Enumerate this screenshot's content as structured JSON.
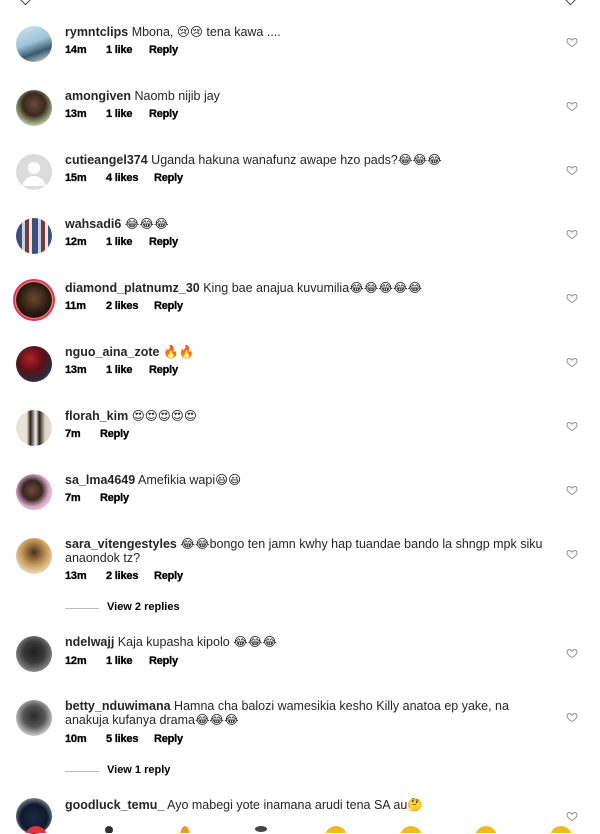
{
  "comments": [
    {
      "username": "rymntclips",
      "text": " Mbona, 😢😢 tena kawa ....",
      "time": "14m",
      "likes": "1 like",
      "reply": "Reply"
    },
    {
      "username": "amongiven",
      "text": " Naomb nijib jay",
      "time": "13m",
      "likes": "1 like",
      "reply": "Reply"
    },
    {
      "username": "cutieangel374",
      "text": " Uganda hakuna wanafunz awape hzo pads?😂😂😂",
      "time": "15m",
      "likes": "4 likes",
      "reply": "Reply"
    },
    {
      "username": "wahsadi6",
      "text": " 😂😂😂",
      "time": "12m",
      "likes": "1 like",
      "reply": "Reply"
    },
    {
      "username": "diamond_platnumz_30",
      "text": " King bae anajua kuvumilia😂😂😂😂😂",
      "time": "11m",
      "likes": "2 likes",
      "reply": "Reply"
    },
    {
      "username": "nguo_aina_zote",
      "text": " 🔥🔥",
      "time": "13m",
      "likes": "1 like",
      "reply": "Reply"
    },
    {
      "username": "florah_kim",
      "text": " 😍😍😍😍😍",
      "time": "7m",
      "likes": "",
      "reply": "Reply"
    },
    {
      "username": "sa_lma4649",
      "text": " Amefikia wapi😃😃",
      "time": "7m",
      "likes": "",
      "reply": "Reply"
    },
    {
      "username": "sara_vitengestyles",
      "text": " 😂😂bongo ten jamn  kwhy hap tuandae bando la  shngp mpk siku anaondok tz?",
      "time": "13m",
      "likes": "2 likes",
      "reply": "Reply",
      "view_replies": "View 2 replies"
    },
    {
      "username": "ndelwajj",
      "text": " Kaja kupasha kipolo 😂😂😂",
      "time": "12m",
      "likes": "1 like",
      "reply": "Reply"
    },
    {
      "username": "betty_nduwimana",
      "text": " Hamna cha balozi wamesikia kesho Killy anatoa ep yake, na anakuja kufanya drama😂😂😂",
      "time": "10m",
      "likes": "5 likes",
      "reply": "Reply",
      "view_replies": "View 1 reply"
    },
    {
      "username": "goodluck_temu_",
      "text": " Ayo mabegi yote inamana arudi tena SA au🤔",
      "time": "",
      "likes": "",
      "reply": ""
    }
  ],
  "icons": {
    "heart": "heart-outline-icon",
    "chevron": "chevron-down-icon"
  },
  "colors": {
    "text": "#262626",
    "heart_stroke": "#8e8e8e",
    "story_ring": "#e1306c"
  }
}
